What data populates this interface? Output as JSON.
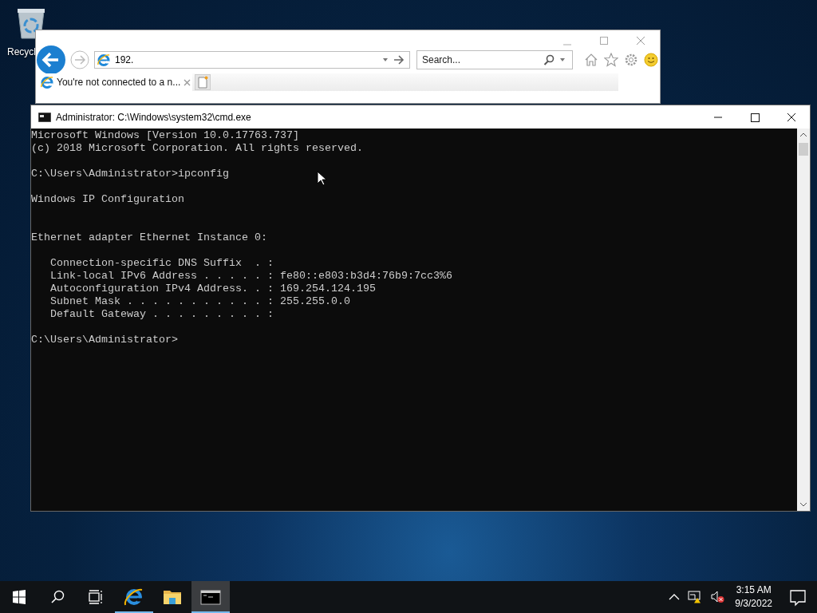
{
  "desktop": {
    "icons": [
      {
        "label": "Recycl"
      }
    ]
  },
  "browser": {
    "address": {
      "value": "192."
    },
    "search": {
      "placeholder": "Search..."
    },
    "tabs": [
      {
        "label": "You're not connected to a n...",
        "selected": true
      }
    ]
  },
  "console": {
    "title": "Administrator: C:\\Windows\\system32\\cmd.exe",
    "blocks": [
      {
        "kind": "text",
        "lines": [
          "Microsoft Windows [Version 10.0.17763.737]",
          "(c) 2018 Microsoft Corporation. All rights reserved."
        ]
      },
      {
        "kind": "text",
        "lines": [
          "C:\\Users\\Administrator>ipconfig"
        ]
      },
      {
        "kind": "heading",
        "lines": [
          "Windows IP Configuration"
        ]
      },
      {
        "kind": "text",
        "lines": [
          "Ethernet adapter Ethernet Instance 0:"
        ]
      },
      {
        "kind": "text",
        "lines": [
          "   Connection-specific DNS Suffix  . :",
          "   Link-local IPv6 Address . . . . . : fe80::e803:b3d4:76b9:7cc3%6",
          "   Autoconfiguration IPv4 Address. . : 169.254.124.195",
          "   Subnet Mask . . . . . . . . . . . : 255.255.0.0",
          "   Default Gateway . . . . . . . . . :"
        ]
      },
      {
        "kind": "text",
        "lines": [
          "C:\\Users\\Administrator>"
        ]
      }
    ]
  },
  "taskbar": {
    "apps": [
      {
        "kind": "browser",
        "running": true,
        "selected": false
      },
      {
        "kind": "folder",
        "running": false,
        "selected": false
      },
      {
        "kind": "console",
        "running": true,
        "selected": true
      }
    ],
    "clock": {
      "time": "3:15 AM",
      "date": "9/3/2022"
    }
  }
}
